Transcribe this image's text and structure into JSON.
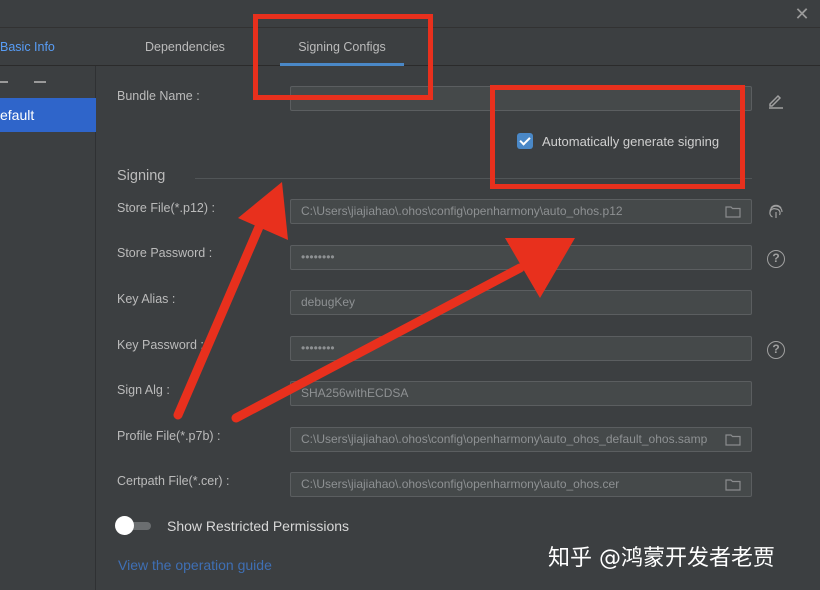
{
  "window": {
    "close_icon": "close-icon"
  },
  "tabs": [
    {
      "label": "Basic Info"
    },
    {
      "label": "Dependencies"
    },
    {
      "label": "Signing Configs"
    }
  ],
  "sidebar": {
    "add_icon": "minus-icon",
    "remove_icon": "minus-icon",
    "selected_item": "efault"
  },
  "form": {
    "bundle_name_label": "Bundle Name :",
    "auto_sign_label": "Automatically generate signing",
    "auto_sign_checked": true,
    "section_title": "Signing",
    "fields": [
      {
        "label": "Store File(*.p12) :",
        "value": "C:\\Users\\jiajiahao\\.ohos\\config\\openharmony\\auto_ohos.p12",
        "icon": "folder-icon",
        "side_icon": "fingerprint-icon"
      },
      {
        "label": "Store Password :",
        "value": "••••••••",
        "side_icon": "help-icon"
      },
      {
        "label": "Key Alias :",
        "value": "debugKey"
      },
      {
        "label": "Key Password :",
        "value": "••••••••",
        "side_icon": "help-icon"
      },
      {
        "label": "Sign Alg :",
        "value": "SHA256withECDSA"
      },
      {
        "label": "Profile File(*.p7b) :",
        "value": "C:\\Users\\jiajiahao\\.ohos\\config\\openharmony\\auto_ohos_default_ohos.samp",
        "icon": "folder-icon"
      },
      {
        "label": "Certpath File(*.cer) :",
        "value": "C:\\Users\\jiajiahao\\.ohos\\config\\openharmony\\auto_ohos.cer",
        "icon": "folder-icon"
      }
    ],
    "help_symbol": "?",
    "show_restricted_label": "Show Restricted Permissions",
    "show_restricted_on": false,
    "guide_link": "View the operation guide"
  },
  "watermark": "知乎 @鸿蒙开发者老贾",
  "colors": {
    "annotation": "#e8301d",
    "accent": "#4a88c7",
    "selected": "#2f65ca",
    "link": "#3f6fb4"
  }
}
